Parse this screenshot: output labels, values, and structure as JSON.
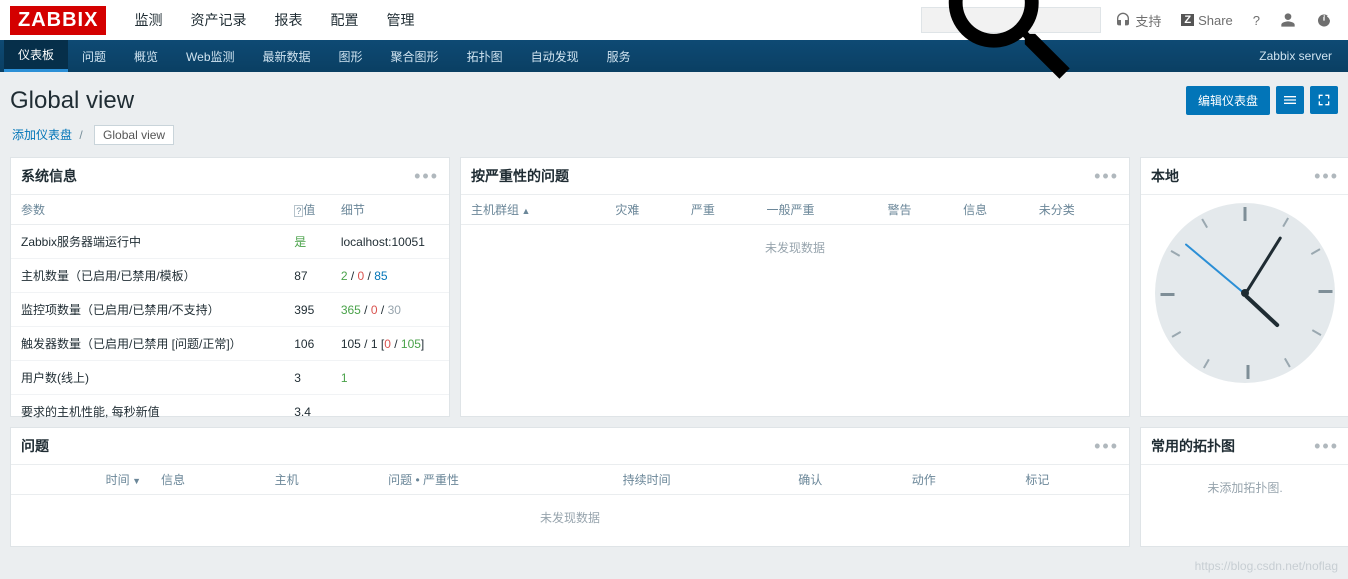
{
  "logo": "ZABBIX",
  "topnav": [
    "监测",
    "资产记录",
    "报表",
    "配置",
    "管理"
  ],
  "topnav_active": 0,
  "header": {
    "support": "支持",
    "share": "Share",
    "share_logo": "Z",
    "question": "?"
  },
  "subnav": [
    "仪表板",
    "问题",
    "概览",
    "Web监测",
    "最新数据",
    "图形",
    "聚合图形",
    "拓扑图",
    "自动发现",
    "服务"
  ],
  "subnav_active": 0,
  "subnav_right": "Zabbix server",
  "page_title": "Global view",
  "edit_btn": "编辑仪表盘",
  "breadcrumb": {
    "add": "添加仪表盘",
    "sep": "/",
    "current": "Global view"
  },
  "sysinfo": {
    "title": "系统信息",
    "cols": [
      "参数",
      "值",
      "细节"
    ],
    "col_value_prefix": "?",
    "rows": [
      {
        "p": "Zabbix服务器端运行中",
        "v": {
          "text": "是",
          "cls": "green"
        },
        "d": [
          {
            "text": "localhost:10051"
          }
        ]
      },
      {
        "p": "主机数量（已启用/已禁用/模板）",
        "v": {
          "text": "87"
        },
        "d": [
          {
            "text": "2",
            "cls": "green"
          },
          {
            "text": " / "
          },
          {
            "text": "0",
            "cls": "red"
          },
          {
            "text": " / "
          },
          {
            "text": "85",
            "cls": "link"
          }
        ]
      },
      {
        "p": "监控项数量（已启用/已禁用/不支持）",
        "v": {
          "text": "395"
        },
        "d": [
          {
            "text": "365",
            "cls": "green"
          },
          {
            "text": " / "
          },
          {
            "text": "0",
            "cls": "red"
          },
          {
            "text": " / "
          },
          {
            "text": "30",
            "cls": "grey"
          }
        ]
      },
      {
        "p": "触发器数量（已启用/已禁用 [问题/正常]）",
        "v": {
          "text": "106"
        },
        "d": [
          {
            "text": "105 / 1 ["
          },
          {
            "text": "0",
            "cls": "red"
          },
          {
            "text": " / "
          },
          {
            "text": "105",
            "cls": "green"
          },
          {
            "text": "]"
          }
        ]
      },
      {
        "p": "用户数(线上)",
        "v": {
          "text": "3"
        },
        "d": [
          {
            "text": "1",
            "cls": "green"
          }
        ]
      },
      {
        "p": "要求的主机性能, 每秒新值",
        "v": {
          "text": "3.4"
        },
        "d": []
      }
    ]
  },
  "severity": {
    "title": "按严重性的问题",
    "cols": [
      "主机群组",
      "灾难",
      "严重",
      "一般严重",
      "警告",
      "信息",
      "未分类"
    ],
    "nodata": "未发现数据"
  },
  "clock": {
    "title": "本地"
  },
  "problems": {
    "title": "问题",
    "cols": [
      "时间",
      "信息",
      "主机",
      "问题 • 严重性",
      "持续时间",
      "确认",
      "动作",
      "标记"
    ],
    "nodata": "未发现数据"
  },
  "maps": {
    "title": "常用的拓扑图",
    "empty": "未添加拓扑图."
  },
  "watermark": "https://blog.csdn.net/noflag"
}
